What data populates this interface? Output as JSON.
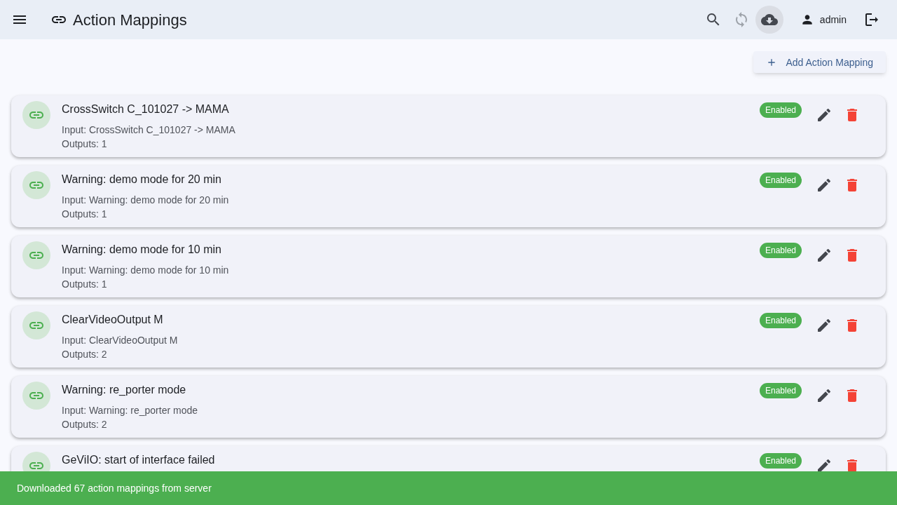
{
  "app_bar": {
    "title": "Action Mappings",
    "actions": [
      {
        "kind": "search",
        "disabled": false,
        "active": false
      },
      {
        "kind": "sync",
        "disabled": true,
        "active": false
      },
      {
        "kind": "download",
        "disabled": false,
        "active": true
      }
    ],
    "user": "admin"
  },
  "add_button": "Add Action Mapping",
  "mappings": [
    {
      "title": "CrossSwitch C_101027 -> MAMA",
      "input": "Input: CrossSwitch C_101027 -> MAMA",
      "outputs": "Outputs: 1",
      "status": "Enabled",
      "enabled": true
    },
    {
      "title": "Warning: demo mode for 20 min",
      "input": "Input: Warning: demo mode for 20 min",
      "outputs": "Outputs: 1",
      "status": "Enabled",
      "enabled": true
    },
    {
      "title": "Warning: demo mode for 10 min",
      "input": "Input: Warning: demo mode for 10 min",
      "outputs": "Outputs: 1",
      "status": "Enabled",
      "enabled": true
    },
    {
      "title": "ClearVideoOutput M",
      "input": "Input: ClearVideoOutput M",
      "outputs": "Outputs: 2",
      "status": "Enabled",
      "enabled": true
    },
    {
      "title": "Warning: re_porter mode",
      "input": "Input: Warning: re_porter mode",
      "outputs": "Outputs: 2",
      "status": "Enabled",
      "enabled": true
    },
    {
      "title": "GeViIO: start of interface failed",
      "status": "Enabled",
      "enabled": true
    }
  ],
  "snackbar": "Downloaded 67 action mappings from server"
}
